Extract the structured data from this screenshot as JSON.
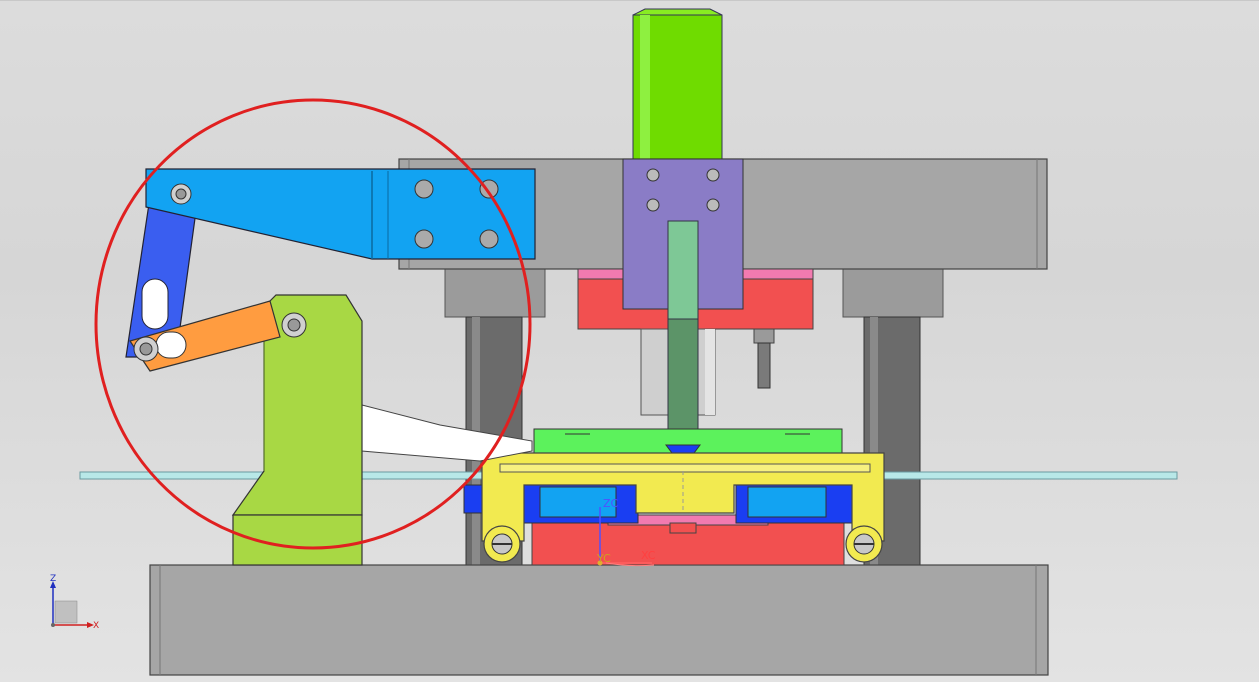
{
  "viewport": {
    "background": "#d8d8d8",
    "highlight_color": "#e02020"
  },
  "wcs": {
    "z_label": "ZC",
    "y_label": "YC",
    "x_label": "XC"
  },
  "view_triad": {
    "z_label": "Z",
    "x_label": "X"
  },
  "part_colors": {
    "upper_plate": "#a6a6a6",
    "lower_plate": "#a6a6a6",
    "shank": "#6fdc00",
    "punch_holder": "#8a7cc6",
    "punch": "#5c9468",
    "upper_pad": "#f25050",
    "blue_arm": "#12a3f2",
    "link": "#3a5ef0",
    "orange_link": "#ff9c40",
    "yellow_bracket": "#a8d844",
    "stripper": "#f2ea50",
    "die_block": "#f25050",
    "green_die": "#5cf25c",
    "strip": "#b8e8e8"
  },
  "icons": [
    "view-triad-icon",
    "wcs-origin-icon"
  ]
}
